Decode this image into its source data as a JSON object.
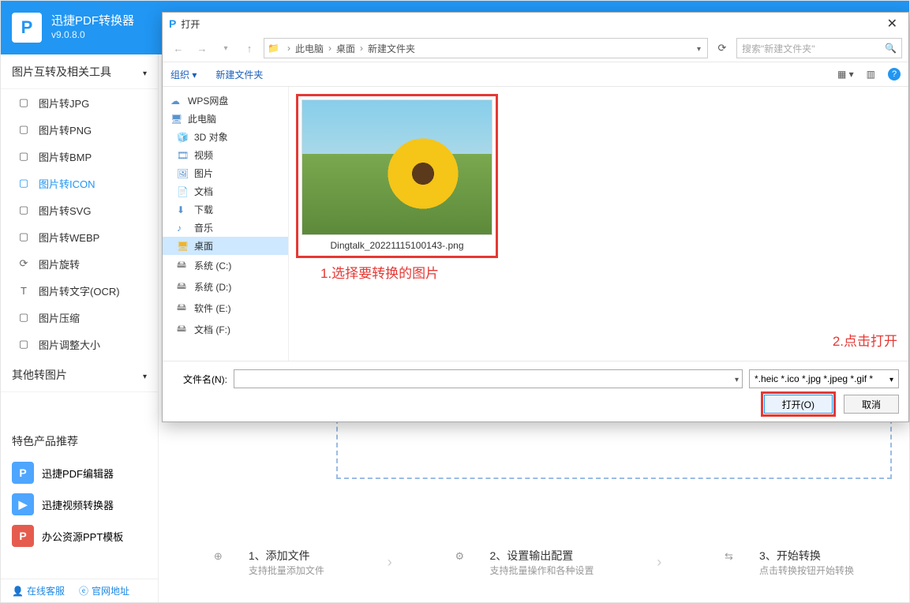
{
  "app": {
    "title": "迅捷PDF转换器",
    "version": "v9.0.8.0"
  },
  "sidebar": {
    "group1_title": "图片互转及相关工具",
    "items": [
      {
        "label": "图片转JPG"
      },
      {
        "label": "图片转PNG"
      },
      {
        "label": "图片转BMP"
      },
      {
        "label": "图片转ICON"
      },
      {
        "label": "图片转SVG"
      },
      {
        "label": "图片转WEBP"
      },
      {
        "label": "图片旋转"
      },
      {
        "label": "图片转文字(OCR)"
      },
      {
        "label": "图片压缩"
      },
      {
        "label": "图片调整大小"
      }
    ],
    "group2_title": "其他转图片",
    "featured_title": "特色产品推荐",
    "featured": [
      {
        "label": "迅捷PDF编辑器"
      },
      {
        "label": "迅捷视频转换器"
      },
      {
        "label": "办公资源PPT模板"
      }
    ],
    "footer": {
      "service": "在线客服",
      "site": "官网地址"
    }
  },
  "steps": [
    {
      "t1": "1、添加文件",
      "t2": "支持批量添加文件"
    },
    {
      "t1": "2、设置输出配置",
      "t2": "支持批量操作和各种设置"
    },
    {
      "t1": "3、开始转换",
      "t2": "点击转换按钮开始转换"
    }
  ],
  "dialog": {
    "title": "打开",
    "breadcrumb": [
      "此电脑",
      "桌面",
      "新建文件夹"
    ],
    "search_placeholder": "搜索\"新建文件夹\"",
    "toolbar": {
      "organize": "组织",
      "new_folder": "新建文件夹"
    },
    "tree": [
      {
        "label": "WPS网盘",
        "lvl": 0,
        "icon": "cloud"
      },
      {
        "label": "此电脑",
        "lvl": 0,
        "icon": "pc"
      },
      {
        "label": "3D 对象",
        "lvl": 1,
        "icon": "3d"
      },
      {
        "label": "视频",
        "lvl": 1,
        "icon": "video"
      },
      {
        "label": "图片",
        "lvl": 1,
        "icon": "image"
      },
      {
        "label": "文档",
        "lvl": 1,
        "icon": "doc"
      },
      {
        "label": "下载",
        "lvl": 1,
        "icon": "download"
      },
      {
        "label": "音乐",
        "lvl": 1,
        "icon": "music"
      },
      {
        "label": "桌面",
        "lvl": 1,
        "icon": "desktop",
        "selected": true
      },
      {
        "label": "系统 (C:)",
        "lvl": 1,
        "icon": "drive"
      },
      {
        "label": "系统 (D:)",
        "lvl": 1,
        "icon": "drive"
      },
      {
        "label": "软件 (E:)",
        "lvl": 1,
        "icon": "drive"
      },
      {
        "label": "文档 (F:)",
        "lvl": 1,
        "icon": "drive"
      }
    ],
    "file": {
      "name": "Dingtalk_20221115100143-.png"
    },
    "footer": {
      "filename_label": "文件名(N):",
      "filter": "*.heic *.ico *.jpg *.jpeg *.gif *",
      "open": "打开(O)",
      "cancel": "取消"
    }
  },
  "annot": {
    "a1": "1.选择要转换的图片",
    "a2": "2.点击打开"
  }
}
